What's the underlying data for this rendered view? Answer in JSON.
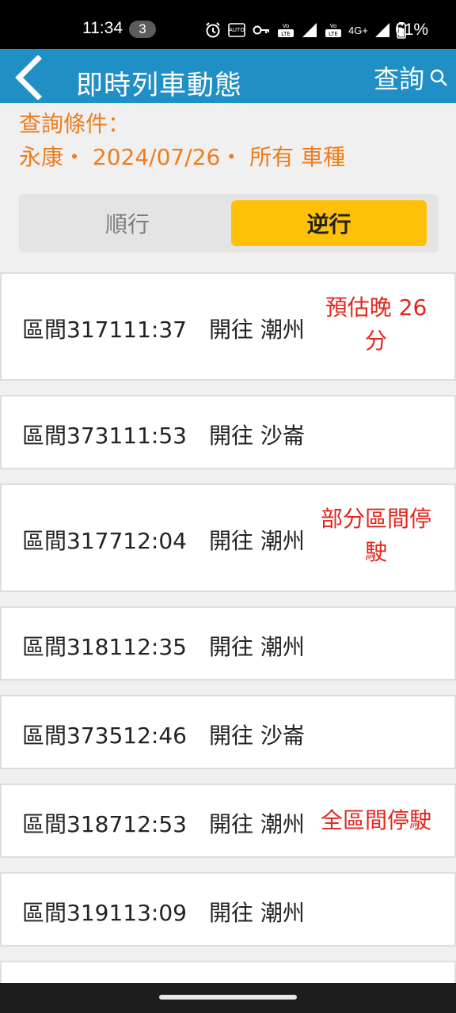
{
  "status_bar": {
    "time": "11:34",
    "notification_count": "3",
    "network_label": "4G+",
    "battery": "61%",
    "icons": [
      "alarm-icon",
      "auto-hz-icon",
      "vpn-key-icon",
      "volte-icon",
      "signal-icon",
      "volte-icon",
      "signal-icon",
      "battery-icon"
    ]
  },
  "app_bar": {
    "title": "即時列車動態",
    "query_label": "查詢"
  },
  "conditions": {
    "label": "查詢條件：",
    "value": "永康・ 2024/07/26・ 所有 車種"
  },
  "direction_tabs": {
    "forward": "順行",
    "reverse": "逆行",
    "selected": "reverse"
  },
  "trains": [
    {
      "text": "區間317111:37　開往 潮州",
      "status": "預估晚 26 分"
    },
    {
      "text": "區間373111:53　開往 沙崙",
      "status": ""
    },
    {
      "text": "區間317712:04　開往 潮州",
      "status": "部分區間停駛"
    },
    {
      "text": "區間318112:35　開往 潮州",
      "status": ""
    },
    {
      "text": "區間373512:46　開往 沙崙",
      "status": ""
    },
    {
      "text": "區間318712:53　開往 潮州",
      "status": "全區間停駛"
    },
    {
      "text": "區間319113:09　開往 潮州",
      "status": ""
    }
  ],
  "colors": {
    "app_bar": "#1f8fc6",
    "conditions_text": "#ef7d1a",
    "selected_tab": "#ffc107",
    "status_text": "#e1261c"
  }
}
